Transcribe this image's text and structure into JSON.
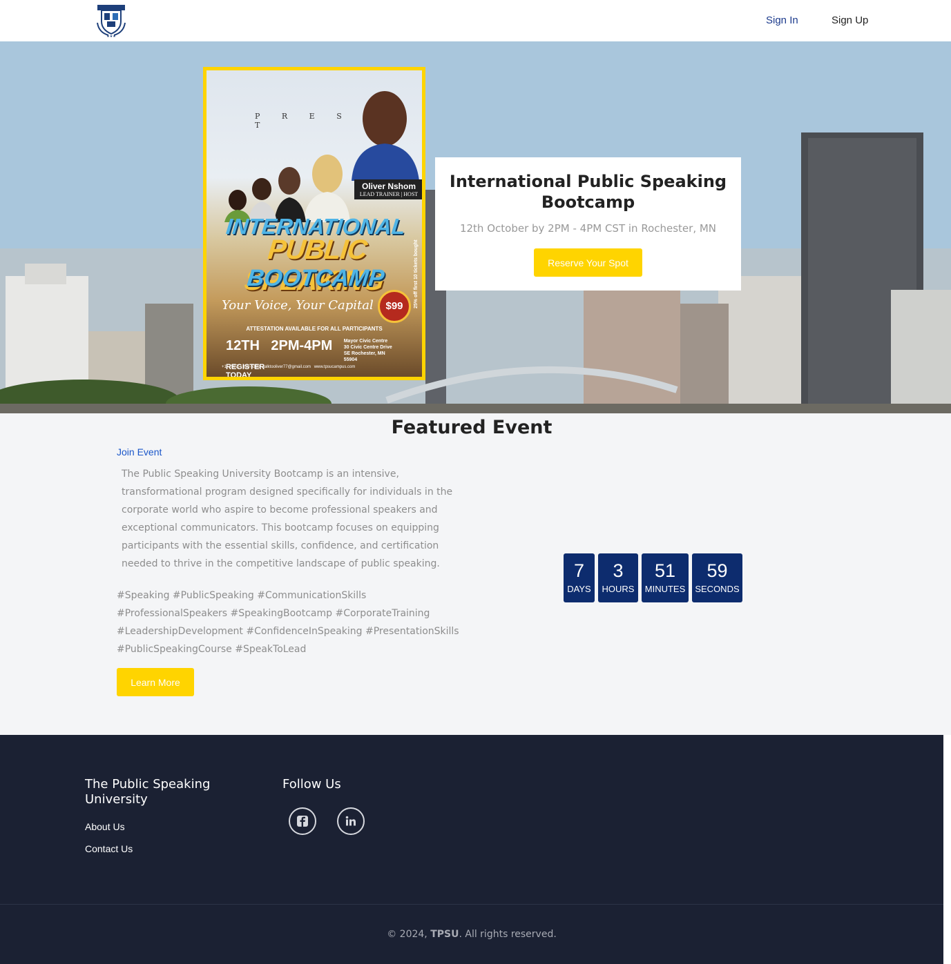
{
  "nav": {
    "logo_icon": "university-crest-icon",
    "sign_in": "Sign In",
    "sign_up": "Sign Up"
  },
  "hero": {
    "poster": {
      "present": "P R E S E N T",
      "host_name": "Oliver Nshom",
      "host_role": "LEAD TRAINER | HOST",
      "line1": "INTERNATIONAL",
      "line2": "PUBLIC SPEAKING",
      "line3": "BOOTCAMP",
      "tagline": "Your Voice, Your Capital",
      "price": "$99",
      "attestation": "ATTESTATION AVAILABLE FOR ALL PARTICIPANTS",
      "date": "12TH",
      "time": "2PM-4PM",
      "venue": "Mayor Civic Centre 30 Civic Centre Drive SE Rochester, MN 55904",
      "register": "REGISTER TODAY",
      "phone": "+1 (507) 319-5381",
      "email": "talktooliver77@gmail.com",
      "website": "www.tpsucampus.com",
      "side_note": "25% off first 10 tickets bought"
    },
    "event_title": "International Public Speaking Bootcamp",
    "event_date": "12th October by 2PM - 4PM CST in Rochester, MN",
    "reserve_label": "Reserve Your Spot"
  },
  "featured": {
    "title": "Featured Event",
    "join_label": "Join Event",
    "description": "The Public Speaking University Bootcamp is an intensive, transformational program designed specifically for individuals in the corporate world who aspire to become professional speakers and exceptional communicators. This bootcamp focuses on equipping participants with the essential skills, confidence, and certification needed to thrive in the competitive landscape of public speaking.",
    "hashtags": "#Speaking #PublicSpeaking #CommunicationSkills #ProfessionalSpeakers #SpeakingBootcamp #CorporateTraining #LeadershipDevelopment #ConfidenceInSpeaking #PresentationSkills #PublicSpeakingCourse #SpeakToLead",
    "learn_more_label": "Learn More",
    "countdown": [
      {
        "value": "7",
        "label": "DAYS"
      },
      {
        "value": "3",
        "label": "HOURS"
      },
      {
        "value": "51",
        "label": "MINUTES"
      },
      {
        "value": "59",
        "label": "SECONDS"
      }
    ]
  },
  "footer": {
    "brand": "The Public Speaking University",
    "about": "About Us",
    "contact": "Contact Us",
    "follow": "Follow Us",
    "social": [
      "facebook-icon",
      "linkedin-icon"
    ],
    "copy_prefix": "© 2024, ",
    "copy_brand": "TPSU",
    "copy_suffix": ". All rights reserved."
  },
  "colors": {
    "accent_yellow": "#ffd400",
    "countdown_blue": "#0d2c6e",
    "footer_bg": "#1b2133",
    "link_blue": "#1a56c9"
  }
}
